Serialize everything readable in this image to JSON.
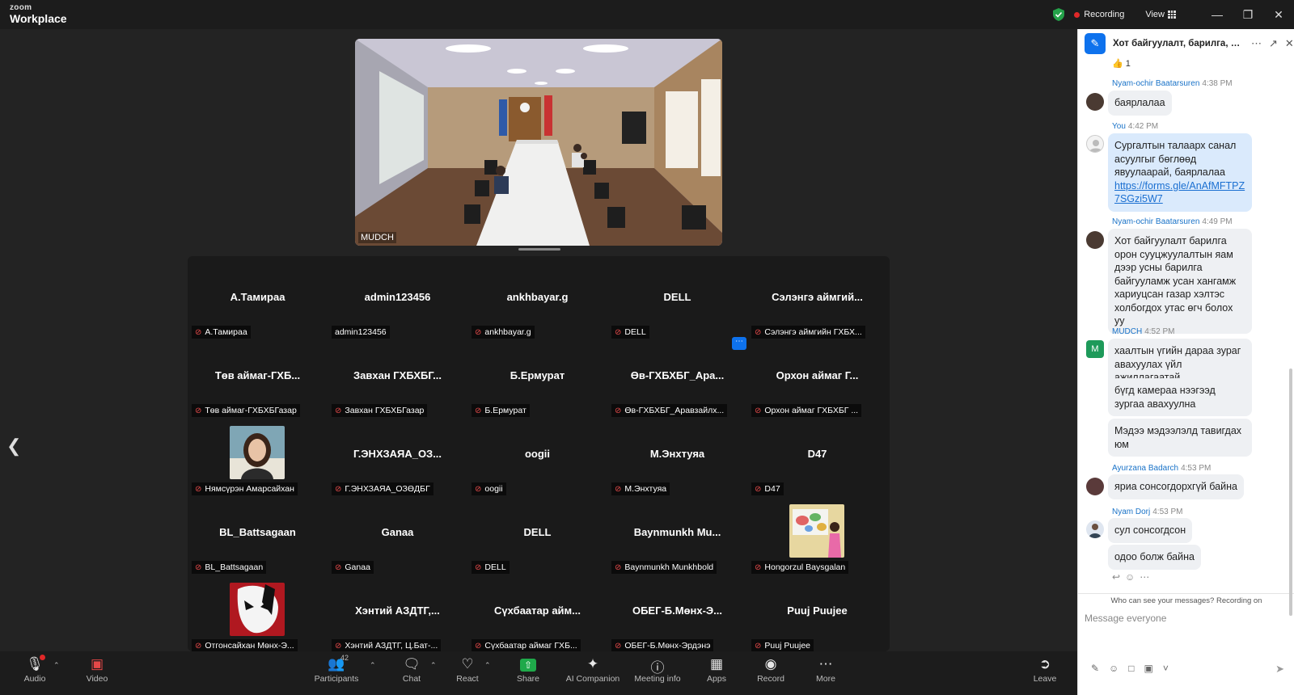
{
  "app": {
    "brand_top": "zoom",
    "brand_bottom": "Workplace"
  },
  "topbar": {
    "recording": "Recording",
    "view": "View"
  },
  "speaker": {
    "name": "MUDCH"
  },
  "gallery": {
    "tiles": [
      {
        "display": "А.Тамираа",
        "label": "А.Тамираа",
        "muted": true
      },
      {
        "display": "admin123456",
        "label": "admin123456",
        "muted": false
      },
      {
        "display": "ankhbayar.g",
        "label": "ankhbayar.g",
        "muted": true
      },
      {
        "display": "DELL",
        "label": "DELL",
        "muted": true
      },
      {
        "display": "Сэлэнгэ аймгий...",
        "label": "Сэлэнгэ аймгийн ГХБХ...",
        "muted": true
      },
      {
        "display": "Төв аймаг-ГХБ...",
        "label": "Төв аймаг-ГХБХБГазар",
        "muted": true
      },
      {
        "display": "Завхан ГХБХБГ...",
        "label": "Завхан ГХБХБГазар",
        "muted": true
      },
      {
        "display": "Б.Ермурат",
        "label": "Б.Ермурат",
        "muted": true
      },
      {
        "display": "Өв-ГХБХБГ_Ара...",
        "label": "Өв-ГХБХБГ_Аравзайлх...",
        "muted": true
      },
      {
        "display": "Орхон аймаг Г...",
        "label": "Орхон аймаг ГХБХБГ ...",
        "muted": true
      },
      {
        "display": "",
        "label": "Нямсүрэн Амарсайхан",
        "muted": true,
        "photo": "woman-portrait"
      },
      {
        "display": "Г.ЭНХЗАЯА_ОЗ...",
        "label": "Г.ЭНХЗАЯА_ОЗӨДБГ",
        "muted": true
      },
      {
        "display": "oogii",
        "label": "oogii",
        "muted": true
      },
      {
        "display": "М.Энхтуяа",
        "label": "М.Энхтуяа",
        "muted": true
      },
      {
        "display": "D47",
        "label": "D47",
        "muted": true
      },
      {
        "display": "BL_Battsagaan",
        "label": "BL_Battsagaan",
        "muted": true
      },
      {
        "display": "Ganaa",
        "label": "Ganaa",
        "muted": true
      },
      {
        "display": "DELL",
        "label": "DELL",
        "muted": true
      },
      {
        "display": "Baynmunkh  Mu...",
        "label": "Baynmunkh Munkhbold",
        "muted": true
      },
      {
        "display": "",
        "label": "Hongorzul Baysgalan",
        "muted": true,
        "photo": "classroom-map"
      },
      {
        "display": "",
        "label": "Отгонсайхан Мөнх-Э...",
        "muted": true,
        "photo": "mask-avatar"
      },
      {
        "display": "Хэнтий АЗДТГ,...",
        "label": "Хэнтий АЗДТГ, Ц.Бат-...",
        "muted": true
      },
      {
        "display": "Сүхбаатар айм...",
        "label": "Сүхбаатар аймаг ГХБ...",
        "muted": true
      },
      {
        "display": "ОБЕГ-Б.Мөнх-Э...",
        "label": "ОБЕГ-Б.Мөнх-Эрдэнэ",
        "muted": true
      },
      {
        "display": "Puuj Puujee",
        "label": "Puuj Puujee",
        "muted": true
      }
    ]
  },
  "chat": {
    "title": "Хот байгуулалт, барилга, о...",
    "reaction": "👍 1",
    "messages": [
      {
        "sender": "Nyam-ochir Baatarsuren",
        "time": "4:38 PM",
        "text": "баярлалаа"
      },
      {
        "sender": "You",
        "time": "4:42 PM",
        "text": "Сургалтын талаарх санал асуулгыг бөглөөд явуулаарай, баярлалаа",
        "link": "https://forms.gle/AnAfMFTPZ7SGzi5W7"
      },
      {
        "sender": "Nyam-ochir Baatarsuren",
        "time": "4:49 PM",
        "text": "Хот байгуулалт барилга орон сууцжуулалтын яам дээр усны барилга байгууламж усан хангамж хариуцсан газар хэлтэс холбогдох утас өгч болох уу"
      },
      {
        "sender": "MUDCH",
        "time": "4:52 PM",
        "text": "хаалтын үгийн дараа зураг авахуулах үйл ажиллагаатай"
      },
      {
        "text": "бүгд камераа нээгээд зургаа авахуулна"
      },
      {
        "text": "Мэдээ мэдээлэлд тавигдах юм"
      },
      {
        "sender": "Ayurzana Badarch",
        "time": "4:53 PM",
        "text": "яриа сонсогдорхгүй байна"
      },
      {
        "sender": "Nyam Dorj",
        "time": "4:53 PM",
        "text": "сул сонсогдсон"
      },
      {
        "text": "одоо болж байна"
      }
    ],
    "notice": "Who can see your messages? Recording on",
    "input_placeholder": "Message everyone",
    "mudch_initial": "M"
  },
  "toolbar": {
    "audio": "Audio",
    "video": "Video",
    "participants": "Participants",
    "participants_count": "42",
    "chat": "Chat",
    "react": "React",
    "share": "Share",
    "ai": "AI Companion",
    "info": "Meeting info",
    "apps": "Apps",
    "record": "Record",
    "more": "More",
    "leave": "Leave"
  },
  "colors": {
    "accent": "#0e72ed",
    "recording": "#e02828",
    "share": "#1fa94a",
    "muted": "#e84b4b"
  }
}
